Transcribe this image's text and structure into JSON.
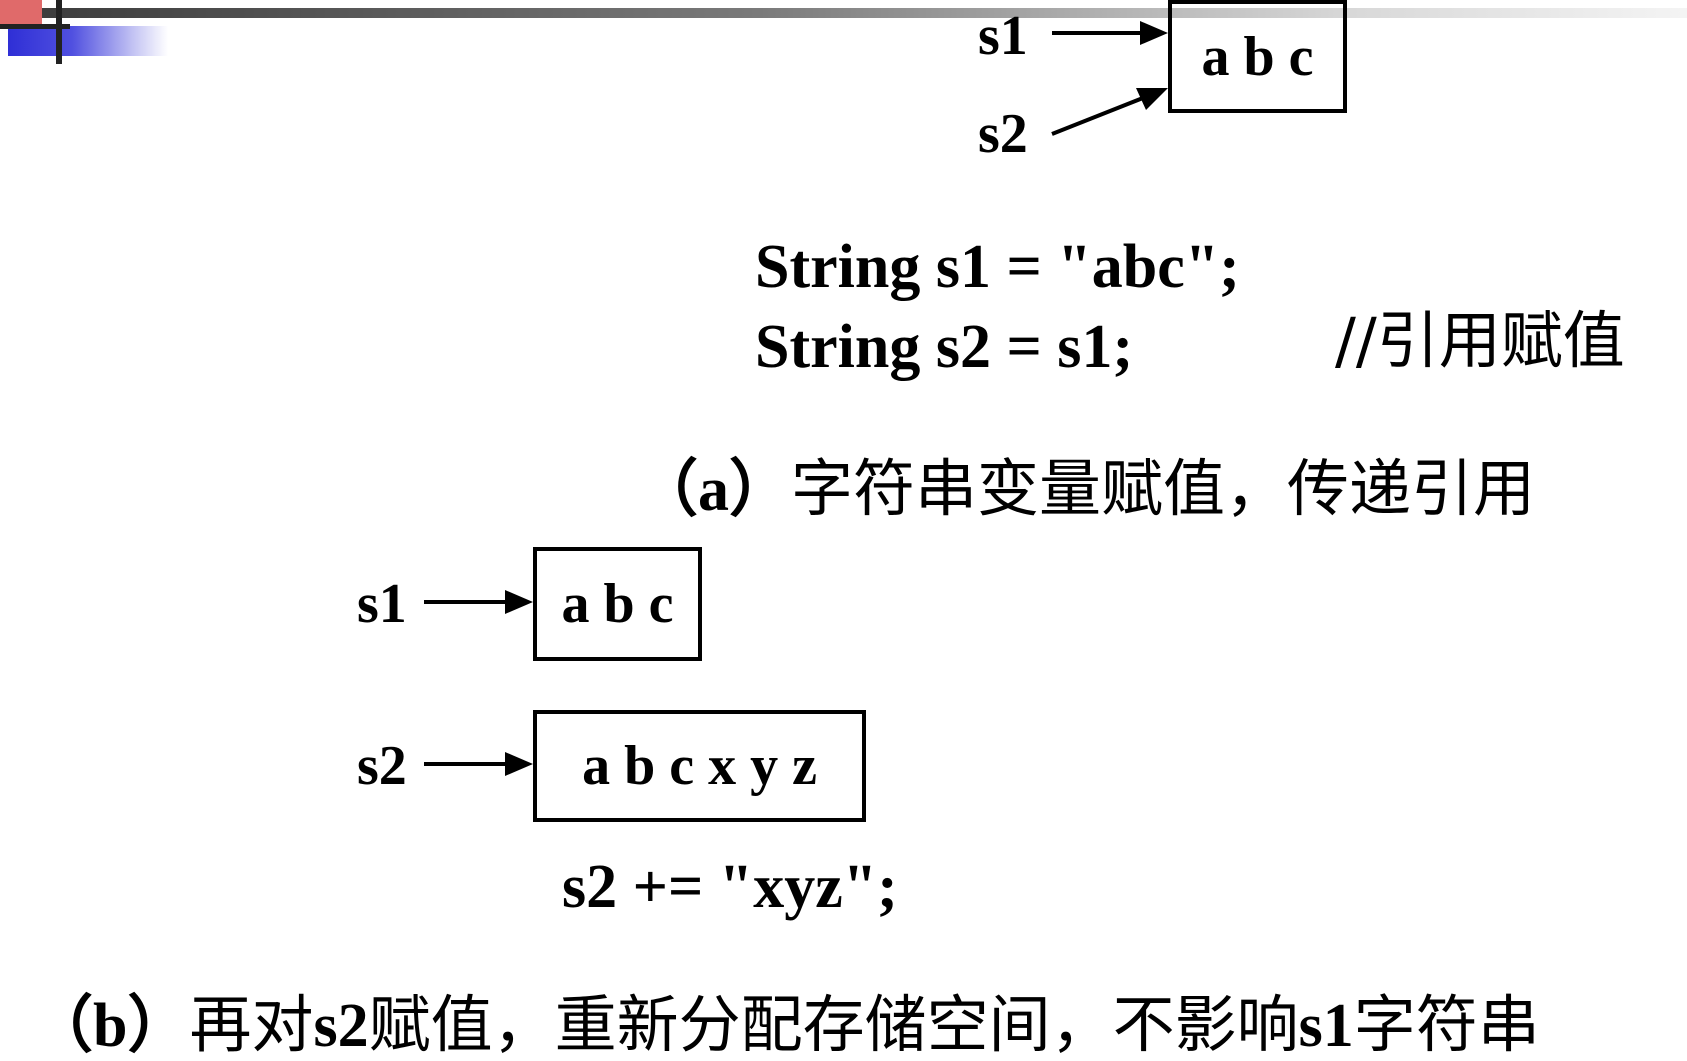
{
  "diagram_a": {
    "var1": "s1",
    "var2": "s2",
    "box_text": "a b c",
    "code_line1": "String s1 = \"abc\";",
    "code_line2": "String s2 = s1;",
    "code_comment": "//引用赋值",
    "caption_prefix": "（a）",
    "caption_text": "字符串变量赋值，传递引用"
  },
  "diagram_b": {
    "var1": "s1",
    "var2": "s2",
    "box1_text": "a b c",
    "box2_text": "a b c x y z",
    "code_line": "s2 += \"xyz\";",
    "caption_prefix": "（b）",
    "caption_part1": "再对",
    "caption_var1": "s2",
    "caption_part2": "赋值，重新分配存储空间，不影响",
    "caption_var2": "s1",
    "caption_part3": "字符串"
  }
}
